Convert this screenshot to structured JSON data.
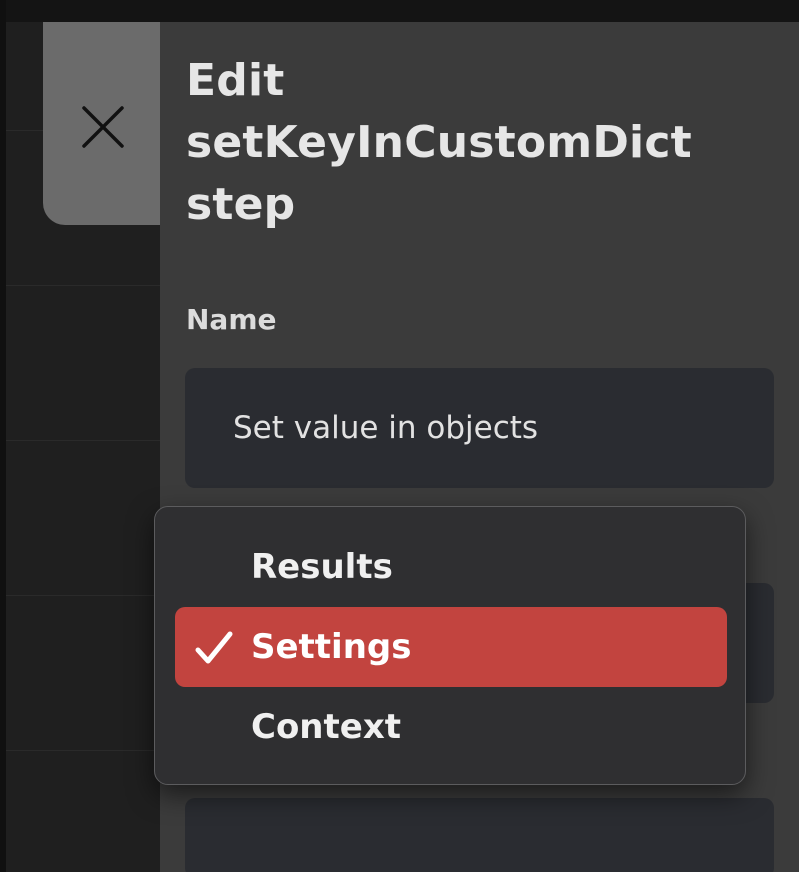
{
  "panel": {
    "title": "Edit setKeyInCustomDict step",
    "close_icon": "close-icon",
    "name_label": "Name",
    "name_value": "Set value in objects"
  },
  "dropdown": {
    "items": [
      {
        "label": "Results",
        "selected": false
      },
      {
        "label": "Settings",
        "selected": true,
        "icon": "checkmark-icon"
      },
      {
        "label": "Context",
        "selected": false
      }
    ]
  },
  "colors": {
    "panel_background": "#3b3b3b",
    "close_tab_background": "#6b6b6b",
    "input_background": "#2a2c31",
    "menu_background": "#2f2f31",
    "selected_accent": "#c2443f"
  }
}
